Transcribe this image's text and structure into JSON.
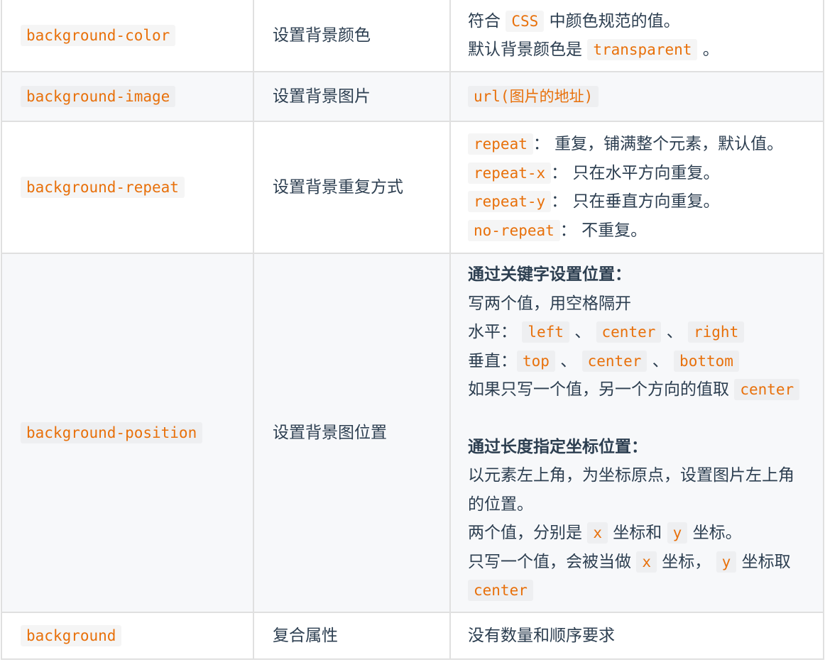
{
  "rows": [
    {
      "property": "background-color",
      "description": "设置背景颜色",
      "values": {
        "l1_a": "符合",
        "l1_code": "CSS",
        "l1_b": "中颜色规范的值。",
        "l2_a": "默认背景颜色是",
        "l2_code": "transparent",
        "l2_b": "。"
      }
    },
    {
      "property": "background-image",
      "description": "设置背景图片",
      "values": {
        "code_a": "url(",
        "text": "图片的地址",
        "code_b": ")"
      }
    },
    {
      "property": "background-repeat",
      "description": "设置背景重复方式",
      "values": [
        {
          "code": "repeat",
          "text": "： 重复，铺满整个元素，默认值。"
        },
        {
          "code": "repeat-x",
          "text": "： 只在水平方向重复。"
        },
        {
          "code": "repeat-y",
          "text": "： 只在垂直方向重复。"
        },
        {
          "code": "no-repeat",
          "text": "： 不重复。"
        }
      ]
    },
    {
      "property": "background-position",
      "description": "设置背景图位置",
      "values": {
        "heading1": "通过关键字设置位置：",
        "line1": "写两个值，用空格隔开",
        "h_label": "水平：",
        "h_left": "left",
        "h_center": "center",
        "h_right": "right",
        "sep": "、",
        "v_label": "垂直：",
        "v_top": "top",
        "v_center": "center",
        "v_bottom": "bottom",
        "single_a": "如果只写一个值，另一个方向的值取",
        "single_code": "center",
        "heading2": "通过长度指定坐标位置：",
        "origin": "以元素左上角，为坐标原点，设置图片左上角的位置。",
        "two_a": "两个值，分别是",
        "x": "x",
        "two_b": "坐标和",
        "y": "y",
        "two_c": "坐标。",
        "one_a": "只写一个值，会被当做",
        "one_b": "坐标，",
        "one_c": "坐标取",
        "one_code": "center"
      }
    },
    {
      "property": "background",
      "description": "复合属性",
      "values": {
        "text": "没有数量和顺序要求"
      }
    }
  ]
}
